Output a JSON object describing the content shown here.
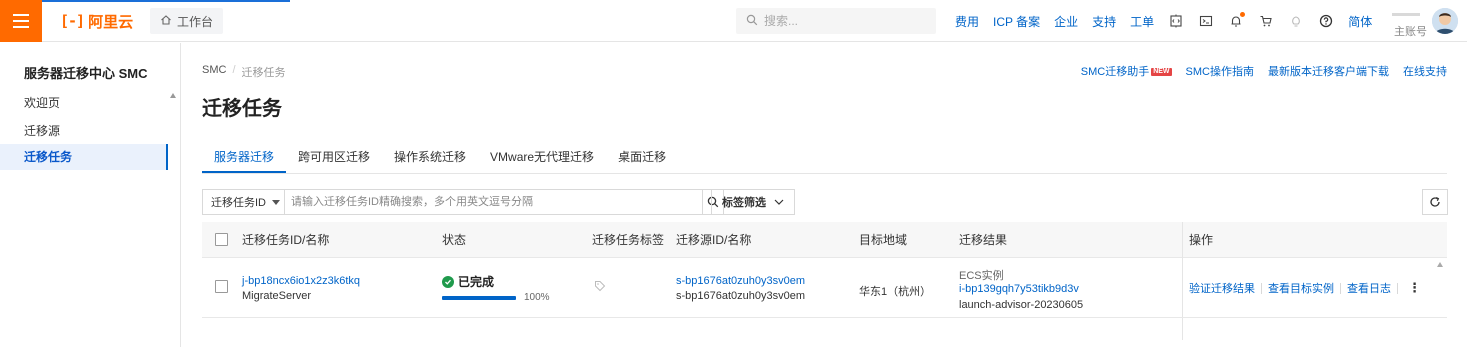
{
  "topbar": {
    "logo_mark": "[-]",
    "logo_text": "阿里云",
    "workbench": "工作台",
    "search_placeholder": "搜索...",
    "links": [
      "费用",
      "ICP 备案",
      "企业",
      "支持",
      "工单"
    ],
    "lang": "简体",
    "account_label": "主账号",
    "icons": [
      "menu-icon",
      "home-icon",
      "search-icon",
      "code-icon",
      "terminal-icon",
      "bell-icon",
      "cart-icon",
      "lightbulb-icon",
      "help-icon"
    ],
    "accent_color": "#ff6a00"
  },
  "sidebar": {
    "title": "服务器迁移中心 SMC",
    "items": [
      {
        "label": "欢迎页"
      },
      {
        "label": "迁移源"
      },
      {
        "label": "迁移任务",
        "active": true
      }
    ]
  },
  "breadcrumb": [
    "SMC",
    "迁移任务"
  ],
  "header_links": [
    "SMC迁移助手",
    "SMC操作指南",
    "最新版本迁移客户端下载",
    "在线支持"
  ],
  "new_badge": "NEW",
  "page_title": "迁移任务",
  "tabs": [
    {
      "label": "服务器迁移",
      "active": true
    },
    {
      "label": "跨可用区迁移"
    },
    {
      "label": "操作系统迁移"
    },
    {
      "label": "VMware无代理迁移"
    },
    {
      "label": "桌面迁移"
    }
  ],
  "filter": {
    "field": "迁移任务ID",
    "placeholder": "请输入迁移任务ID精确搜索，多个用英文逗号分隔",
    "tag_filter": "标签筛选"
  },
  "table": {
    "columns": [
      "迁移任务ID/名称",
      "状态",
      "迁移任务标签",
      "迁移源ID/名称",
      "目标地域",
      "迁移结果",
      "操作"
    ],
    "rows": [
      {
        "task_id": "j-bp18ncx6io1x2z3k6tkq",
        "task_name": "MigrateServer",
        "status": "已完成",
        "progress_text": "100%",
        "progress": 1.0,
        "source_id": "s-bp1676at0zuh0y3sv0em",
        "source_name": "s-bp1676at0zuh0y3sv0em",
        "region": "华东1（杭州）",
        "result_type": "ECS实例",
        "result_instance": "i-bp139gqh7y53tikb9d3v",
        "result_image": "launch-advisor-20230605",
        "actions": [
          "验证迁移结果",
          "查看目标实例",
          "查看日志"
        ],
        "more": "⋮"
      }
    ]
  },
  "colors": {
    "link": "#0064c8",
    "success": "#1f9a4c",
    "brand": "#ff6a00"
  }
}
